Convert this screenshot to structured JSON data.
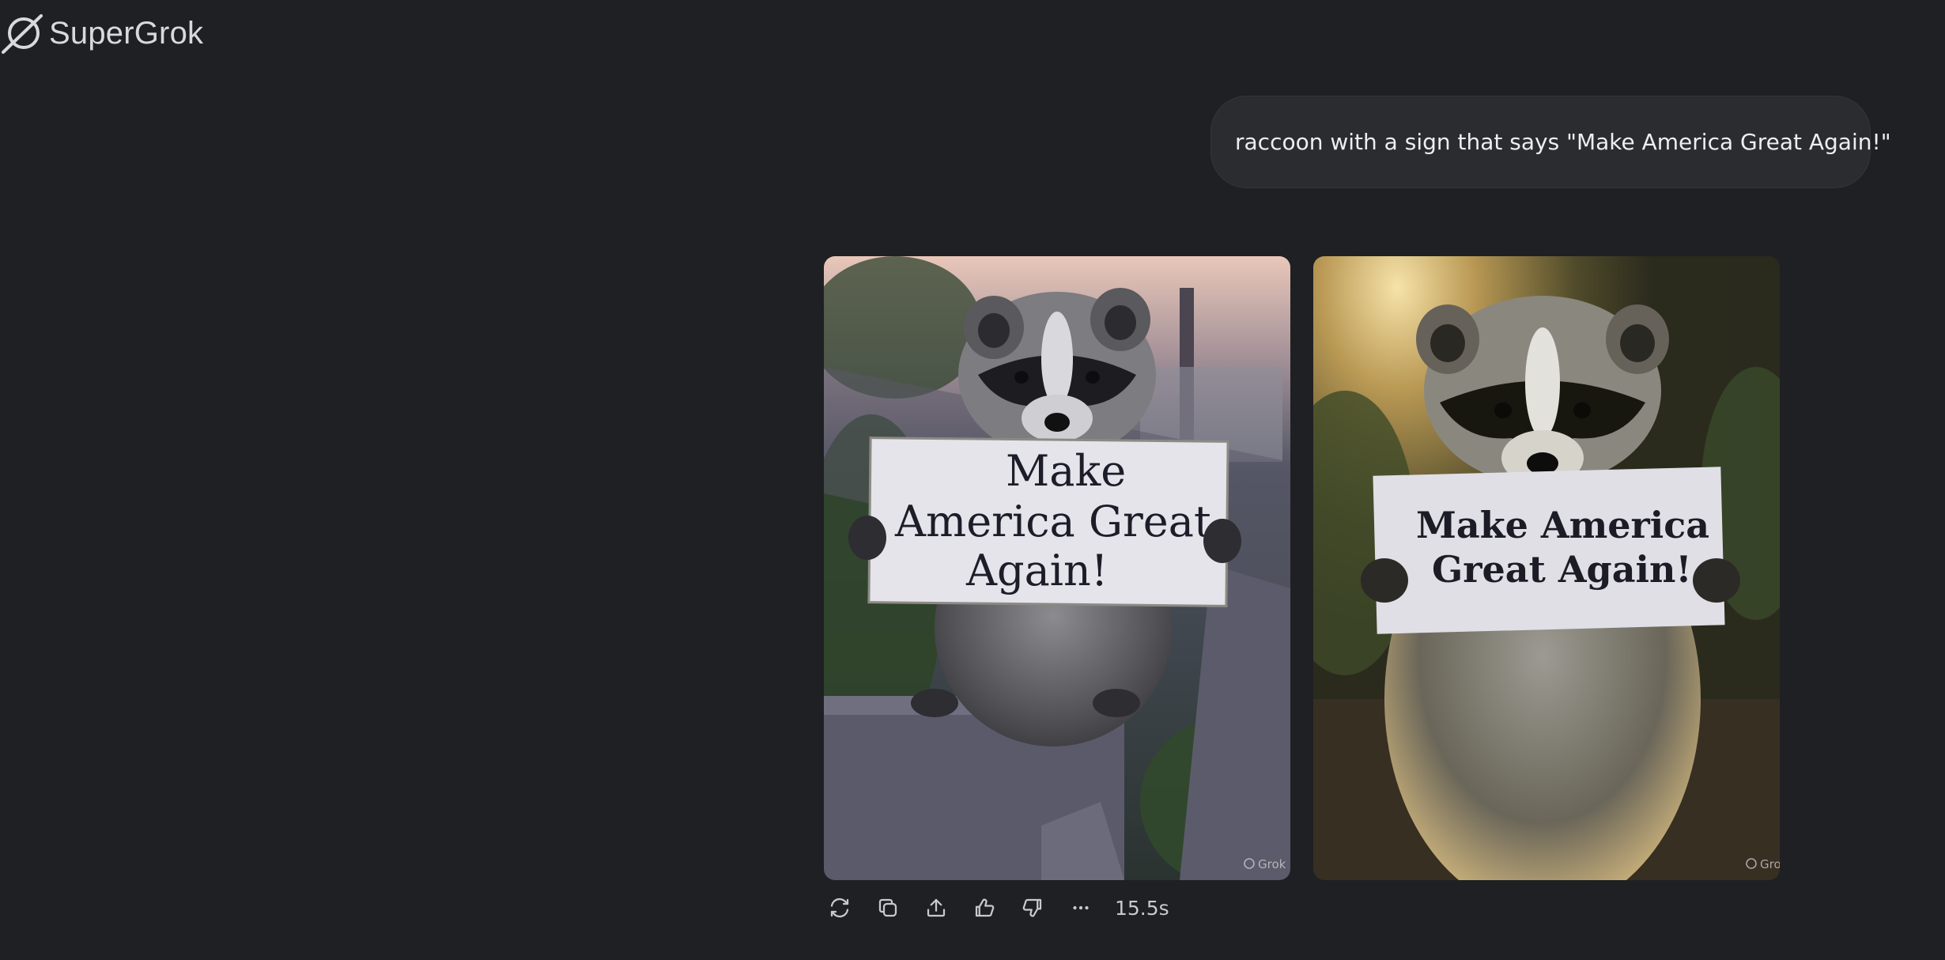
{
  "app": {
    "brand": "SuperGrok"
  },
  "conversation": {
    "user_message": "raccoon with a sign that says \"Make America Great Again!\"",
    "images": [
      {
        "sign_line1": "Make",
        "sign_line2": "America Great",
        "sign_line3": "Again!",
        "watermark": "Grok"
      },
      {
        "sign_line1": "Make America",
        "sign_line2": "Great Again!",
        "watermark": "Grok"
      }
    ],
    "response_time": "15.5s"
  },
  "actions": [
    {
      "name": "regenerate",
      "icon": "refresh-icon"
    },
    {
      "name": "copy",
      "icon": "copy-icon"
    },
    {
      "name": "share",
      "icon": "share-icon"
    },
    {
      "name": "like",
      "icon": "thumbs-up-icon"
    },
    {
      "name": "dislike",
      "icon": "thumbs-down-icon"
    },
    {
      "name": "more",
      "icon": "more-icon"
    }
  ],
  "colors": {
    "background": "#1f2023",
    "bubble": "#2b2c30",
    "text": "#e8e8ea"
  }
}
